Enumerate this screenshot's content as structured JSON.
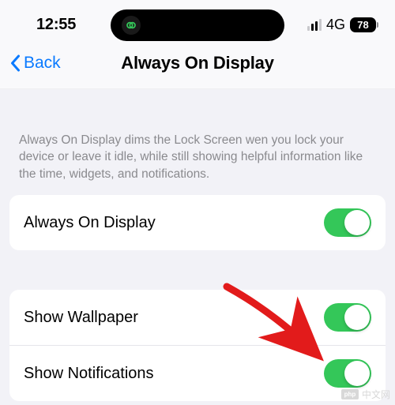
{
  "status": {
    "time": "12:55",
    "network": "4G",
    "battery": "78"
  },
  "nav": {
    "back": "Back",
    "title": "Always On Display"
  },
  "description": "Always On Display dims the Lock Screen wen you lock your device or leave it idle, while still showing helpful information like the time, widgets, and notifications.",
  "settings": {
    "aod_label": "Always On Display",
    "wallpaper_label": "Show Wallpaper",
    "notifications_label": "Show Notifications"
  },
  "watermark": {
    "logo": "php",
    "text": "中文网"
  }
}
